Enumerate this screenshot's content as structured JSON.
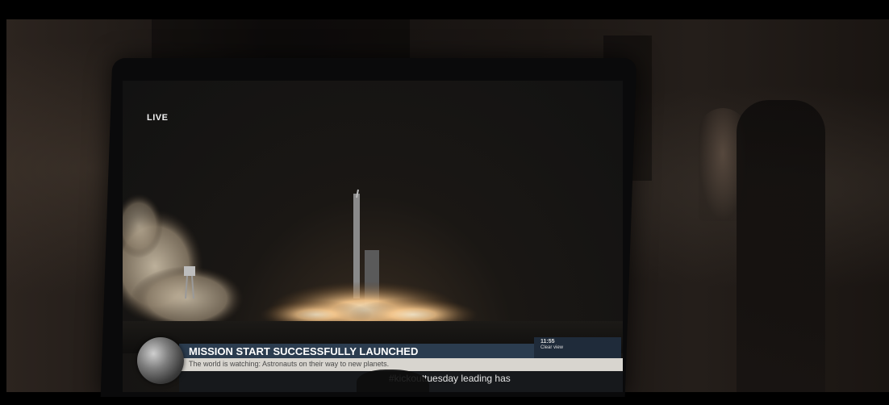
{
  "screen": {
    "live_badge": "LIVE"
  },
  "news_ticker": {
    "headline": "MISSION START SUCCESSFULLY LAUNCHED",
    "subheadline": "The world is watching: Astronauts on their way to new planets.",
    "scroll_text": "#kickouttuesday leading has",
    "clock_time": "11:55",
    "clock_status": "Clear view"
  },
  "colors": {
    "ticker_band": "#2b3c4f",
    "ticker_sub": "#d8d5cf",
    "ticker_bottom": "#17191c",
    "exhaust_glow": "#f2c48a"
  }
}
